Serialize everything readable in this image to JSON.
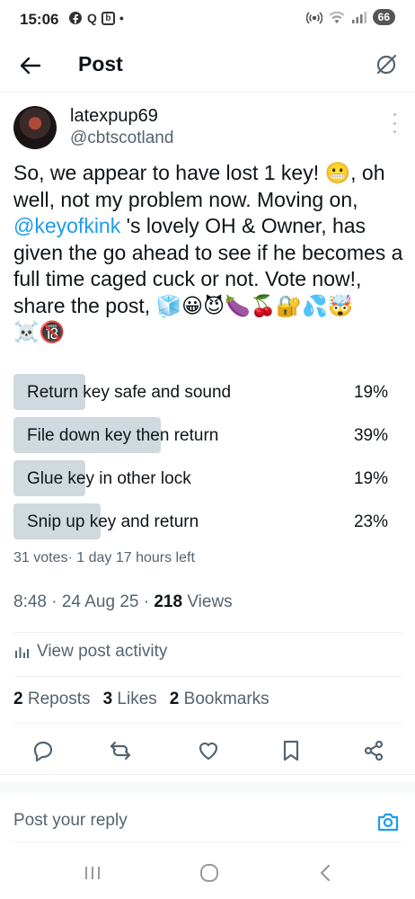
{
  "status": {
    "time": "15:06",
    "left_icons": [
      "Q",
      "b",
      "•"
    ],
    "battery": "66"
  },
  "header": {
    "title": "Post"
  },
  "post": {
    "display_name": "latexpup69",
    "handle": "@cbtscotland",
    "text_before": "So, we appear to have lost 1 key! 😬, oh well, not my problem now. Moving on, ",
    "mention": "@keyofkink",
    "text_after": " 's lovely OH & Owner, has given the go ahead to see if he becomes a full time caged cuck or not. Vote now!, share the post, 🧊😀😈🍆🍒🔐💦🤯☠️🔞"
  },
  "poll": {
    "options": [
      {
        "label": "Return key safe and sound",
        "percent": "19%",
        "fill": 0.19
      },
      {
        "label": "File down key then return",
        "percent": "39%",
        "fill": 0.39
      },
      {
        "label": "Glue key in other lock",
        "percent": "19%",
        "fill": 0.19
      },
      {
        "label": "Snip up key and return",
        "percent": "23%",
        "fill": 0.23
      }
    ],
    "meta": "31 votes· 1 day 17 hours left"
  },
  "timestamp": {
    "time": "8:48 · 24 Aug 25 · ",
    "views_count": "218",
    "views_label": " Views"
  },
  "activity": {
    "label": "View post activity"
  },
  "stats": {
    "reposts_count": "2",
    "reposts_label": "Reposts",
    "likes_count": "3",
    "likes_label": "Likes",
    "bookmarks_count": "2",
    "bookmarks_label": "Bookmarks"
  },
  "reply": {
    "placeholder": "Post your reply"
  },
  "colors": {
    "accent": "#1d9bf0",
    "poll_fill": "#cfd9de",
    "muted_text": "#536471"
  }
}
